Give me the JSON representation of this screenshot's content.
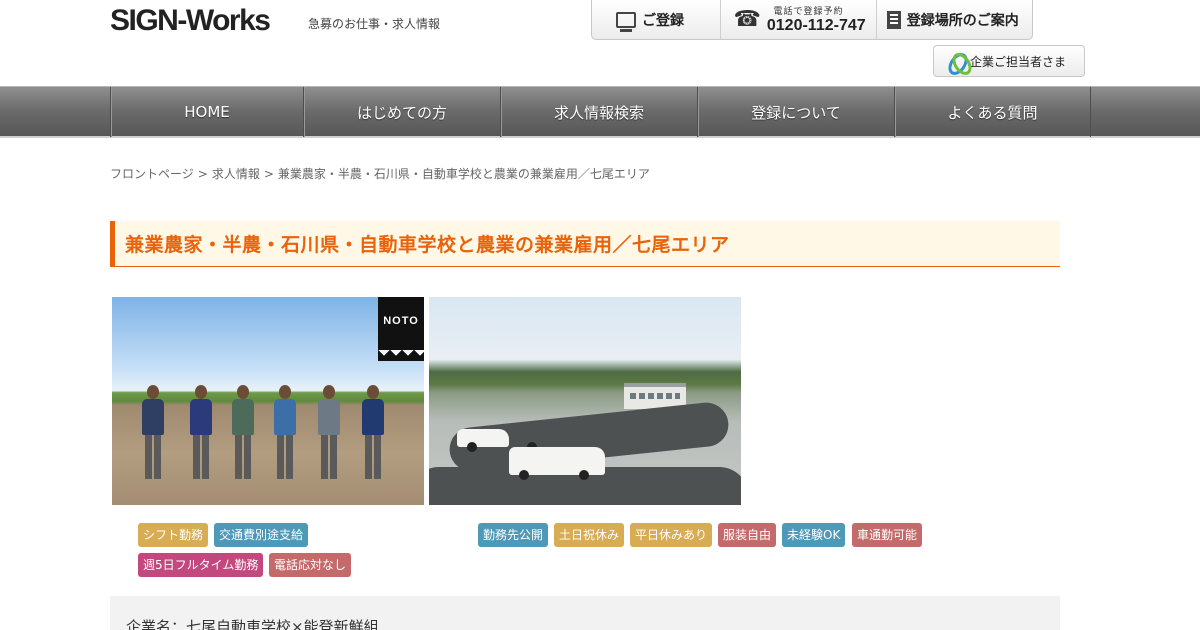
{
  "header": {
    "logo": "SIGN-Works",
    "tagline": "急募のお仕事・求人情報",
    "register_label": "ご登録",
    "tel_caption": "電話で登録予約",
    "tel_number": "0120-112-747",
    "location_label": "登録場所のご案内",
    "corporate_label": "企業ご担当者さま"
  },
  "nav": {
    "items": [
      "HOME",
      "はじめての方",
      "求人情報検索",
      "登録について",
      "よくある質問"
    ]
  },
  "breadcrumb": [
    "フロントページ",
    ">",
    "求人情報",
    ">",
    "兼業農家・半農・石川県・自動車学校と農業の兼業雇用／七尾エリア"
  ],
  "page_title": "兼業農家・半農・石川県・自動車学校と農業の兼業雇用／七尾エリア",
  "photos": {
    "badge": "NOTO"
  },
  "tags_left": [
    {
      "label": "シフト勤務",
      "color": "#d7ac53"
    },
    {
      "label": "交通費別途支給",
      "color": "#4e98b8"
    },
    {
      "label": "週5日フルタイム勤務",
      "color": "#c2487e"
    },
    {
      "label": "電話応対なし",
      "color": "#c46a6a"
    }
  ],
  "tags_right": [
    {
      "label": "勤務先公開",
      "color": "#4e98b8"
    },
    {
      "label": "土日祝休み",
      "color": "#d7ac53"
    },
    {
      "label": "平日休みあり",
      "color": "#d7ac53"
    },
    {
      "label": "服装自由",
      "color": "#c46a6a"
    },
    {
      "label": "未経験OK",
      "color": "#4e98b8"
    },
    {
      "label": "車通勤可能",
      "color": "#c46a6a"
    }
  ],
  "company": {
    "label": "企業名：七尾自動車学校×能登新鮮組"
  },
  "colors": {
    "accent": "#e8630a",
    "nav_bg": "#6a6a6a",
    "title_bg": "#fff8e6"
  }
}
